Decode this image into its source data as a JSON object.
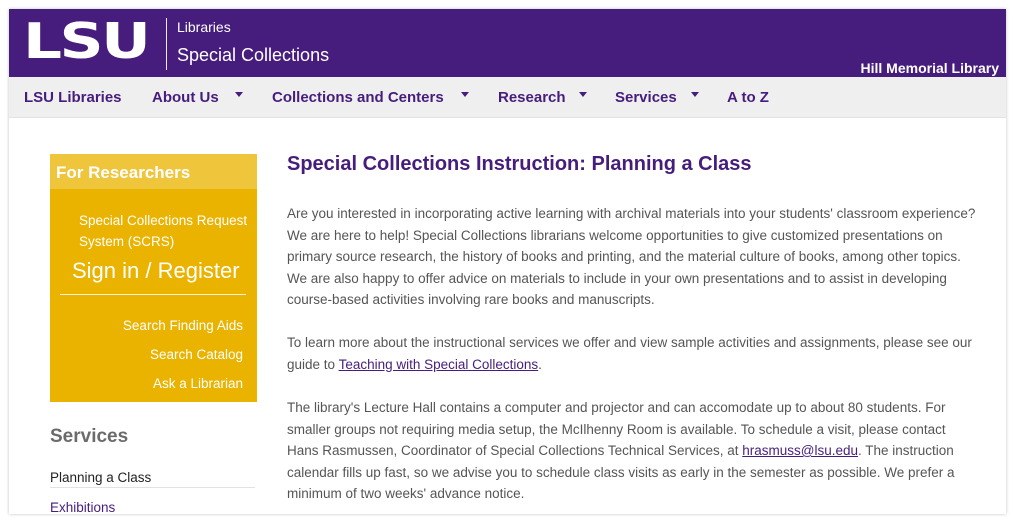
{
  "header": {
    "logo_text": "LSU",
    "libraries_label": "Libraries",
    "site_title": "Special Collections",
    "building": "Hill Memorial Library"
  },
  "nav": {
    "items": [
      {
        "label": "LSU Libraries",
        "has_dropdown": false
      },
      {
        "label": "About Us",
        "has_dropdown": true
      },
      {
        "label": "Collections and Centers",
        "has_dropdown": true
      },
      {
        "label": "Research",
        "has_dropdown": true
      },
      {
        "label": "Services",
        "has_dropdown": true
      },
      {
        "label": "A to Z",
        "has_dropdown": false
      }
    ]
  },
  "sidebar": {
    "box_title": "For Researchers",
    "scrs_text": "Special Collections Request System (SCRS)",
    "signin_label": "Sign in / Register",
    "links": [
      "Search Finding Aids",
      "Search Catalog",
      "Ask a Librarian"
    ],
    "services_heading": "Services",
    "services_items": [
      "Planning a Class",
      "Exhibitions"
    ]
  },
  "main": {
    "title": "Special Collections Instruction: Planning a Class",
    "p1": "Are you interested in incorporating active learning with archival materials into your students' classroom experience? We are here to help! Special Collections librarians welcome opportunities to give customized presentations on primary source research, the history of books and printing, and the material culture of books, among other topics. We are also happy to offer advice on materials to include in your own presentations and to assist in developing course-based activities involving rare books and manuscripts.",
    "p2_before": "To learn more about the instructional services we offer and view sample activities and assignments, please see our guide to ",
    "p2_link": "Teaching with Special Collections",
    "p2_after": ".",
    "p3_before": "The library's Lecture Hall contains a computer and projector and can accomodate up to about 80 students. For smaller groups not requiring media setup, the McIlhenny Room is available. To schedule a visit, please contact Hans Rasmussen, Coordinator of Special Collections Technical Services, at ",
    "p3_link": "hrasmuss@lsu.edu",
    "p3_after": ". The instruction calendar fills up fast, so we advise you to schedule class visits as early in the semester as possible. We prefer a minimum of two weeks' advance notice."
  },
  "colors": {
    "brand_purple": "#461d7c",
    "gold": "#e9b300",
    "gold_light": "#efc53c",
    "nav_bg": "#efeff0",
    "body_text": "#555555"
  }
}
